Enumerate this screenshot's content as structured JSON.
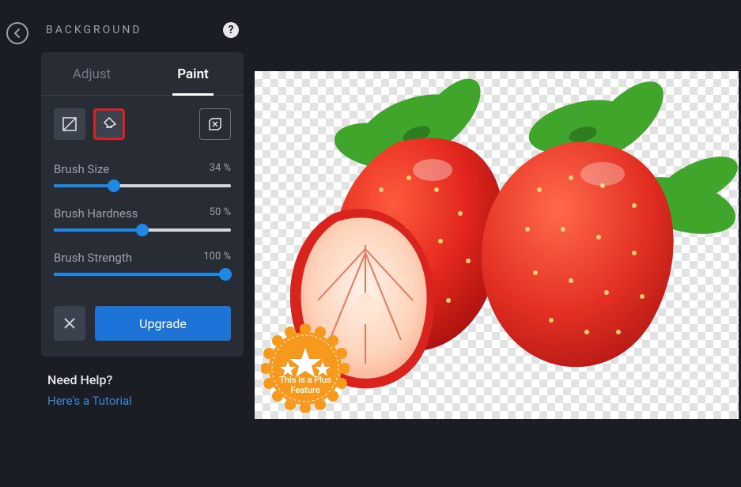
{
  "header": {
    "title": "BACKGROUND"
  },
  "tabs": {
    "adjust": "Adjust",
    "paint": "Paint"
  },
  "sliders": {
    "size": {
      "label": "Brush Size",
      "value": "34 %",
      "pct": 34
    },
    "hardness": {
      "label": "Brush Hardness",
      "value": "50 %",
      "pct": 50
    },
    "strength": {
      "label": "Brush Strength",
      "value": "100 %",
      "pct": 100
    }
  },
  "actions": {
    "upgrade": "Upgrade"
  },
  "help": {
    "title": "Need Help?",
    "link": "Here's a Tutorial"
  },
  "badge": {
    "line1": "This is a Plus",
    "line2": "Feature"
  },
  "icons": {
    "back": "back-arrow-icon",
    "help": "help-icon",
    "restore": "restore-icon",
    "brush": "brush-icon",
    "remove": "remove-section-icon",
    "cancel": "close-icon"
  }
}
